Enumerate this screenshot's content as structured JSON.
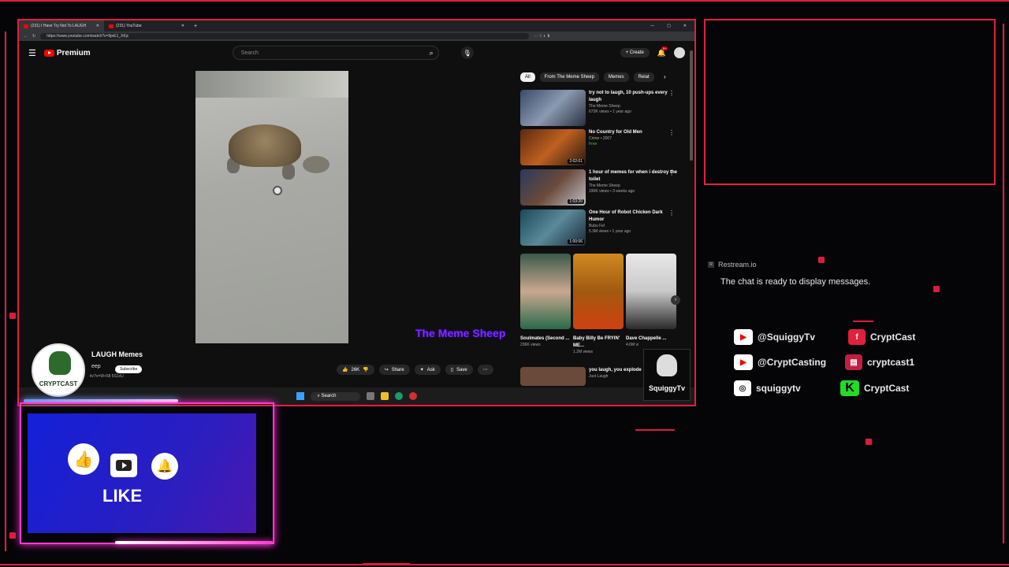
{
  "browser": {
    "tabs": [
      {
        "label": "(231) I Have Try Not To LAUGH",
        "active": true
      },
      {
        "label": "(231) YouTube",
        "active": false
      }
    ],
    "new_tab": "+",
    "url": "https://www.youtube.com/watch?v=9jeE1_XKjc"
  },
  "youtube": {
    "logo_label": "Premium",
    "search_placeholder": "Search",
    "create_label": "Create",
    "notif_badge": "9+",
    "chips": [
      "All",
      "From The Meme Sheep",
      "Memes",
      "Relat"
    ],
    "video_title": "LAUGH Memes",
    "channel_snippet": "eep",
    "subscribe_label": "Subscribe",
    "url_snippet": "itv?v=W+58  5S1xU",
    "watermark": "The Meme Sheep",
    "actions": {
      "likes": "26K",
      "share": "Share",
      "ask": "Ask",
      "save": "Save"
    },
    "recommendations": [
      {
        "title": "try not to laugh, 10 push-ups every laugh",
        "channel": "The Meme Sheep",
        "meta": "673K views • 1 year ago",
        "duration": ""
      },
      {
        "title": "No Country for Old Men",
        "channel": "Crime • 2007",
        "meta": "Free",
        "duration": "2:02:01"
      },
      {
        "title": "1 hour of memes for when i destroy the toilet",
        "channel": "The Meme Sheep",
        "meta": "190K views • 3 weeks ago",
        "duration": "1:03:20"
      },
      {
        "title": "One Hour of Robot Chicken Dark Humor",
        "channel": "Bubu Fel",
        "meta": "5.3M views • 1 year ago",
        "duration": "1:00:06"
      }
    ],
    "shorts": [
      {
        "title": "Soulmates (Second ...",
        "views": "236K views"
      },
      {
        "title": "Baby Billy Be FRYIN' ME...",
        "views": "1.2M views"
      },
      {
        "title": "Dave Chappelle ...",
        "views": "4.6M vi"
      }
    ],
    "partial_rec": {
      "title": "you laugh, you explode",
      "channel": "Just Laugh"
    }
  },
  "taskbar": {
    "search": "Search"
  },
  "overlay": {
    "cryptcast_logo": "CRYPTCAST",
    "squiggy_logo": "SquiggyTv",
    "restream_label": "Restream.io",
    "chat_message": "The chat is ready to display messages.",
    "socials": [
      {
        "platform": "youtube",
        "handle": "@SquiggyTv"
      },
      {
        "platform": "facebook",
        "handle": "CryptCast"
      },
      {
        "platform": "youtube",
        "handle": "@CryptCasting"
      },
      {
        "platform": "twitch",
        "handle": "cryptcast1"
      },
      {
        "platform": "instagram",
        "handle": "squiggytv"
      },
      {
        "platform": "kick",
        "handle": "CryptCast"
      }
    ],
    "like_label": "LIKE"
  },
  "colors": {
    "accent": "#e0203c",
    "neon_pink": "#ff3bd4",
    "panel_blue": "#1a22d0",
    "yt_red": "#ff0000"
  }
}
